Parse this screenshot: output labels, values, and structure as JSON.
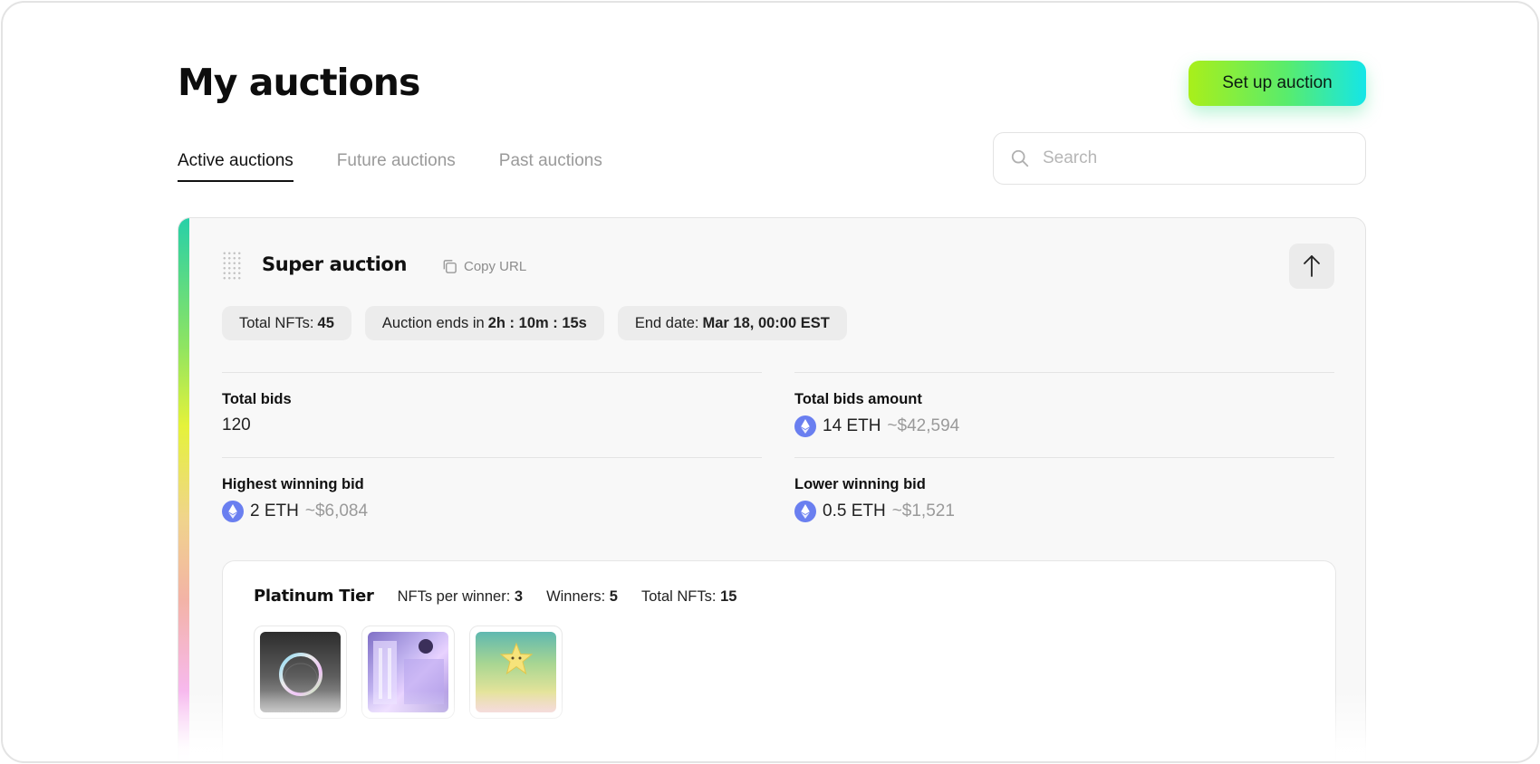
{
  "header": {
    "title": "My auctions",
    "setup_button": "Set up auction"
  },
  "tabs": [
    {
      "label": "Active auctions",
      "active": true
    },
    {
      "label": "Future auctions",
      "active": false
    },
    {
      "label": "Past auctions",
      "active": false
    }
  ],
  "search": {
    "placeholder": "Search",
    "value": ""
  },
  "auction": {
    "title": "Super auction",
    "copy_url": "Copy URL",
    "accent_gradient": [
      "#27d0a8",
      "#8ee462",
      "#e5f23a",
      "#f3b3a6",
      "#f7b9ee"
    ],
    "chips": {
      "total_nfts_label": "Total NFTs:",
      "total_nfts_value": "45",
      "ends_label": "Auction ends in",
      "ends_value": "2h : 10m : 15s",
      "end_date_label": "End date:",
      "end_date_value": "Mar 18, 00:00 EST"
    },
    "stats": {
      "total_bids": {
        "label": "Total bids",
        "value": "120"
      },
      "total_bids_amount": {
        "label": "Total bids amount",
        "eth": "14 ETH",
        "usd": "~$42,594"
      },
      "highest_winning_bid": {
        "label": "Highest winning bid",
        "eth": "2 ETH",
        "usd": "~$6,084"
      },
      "lower_winning_bid": {
        "label": "Lower winning bid",
        "eth": "0.5 ETH",
        "usd": "~$1,521"
      }
    },
    "tier": {
      "name": "Platinum Tier",
      "nfts_per_winner_label": "NFTs per winner:",
      "nfts_per_winner": "3",
      "winners_label": "Winners:",
      "winners": "5",
      "total_nfts_label": "Total NFTs:",
      "total_nfts": "15",
      "thumbnails": [
        "ring-artwork",
        "room-artwork",
        "star-artwork"
      ]
    }
  },
  "colors": {
    "accent_green": "#a9ef1a",
    "accent_cyan": "#14e6e8",
    "eth_blue": "#6a7ff0"
  }
}
